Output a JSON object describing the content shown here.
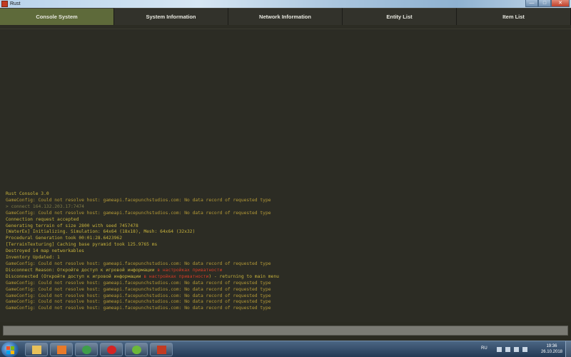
{
  "window": {
    "title": "Rust",
    "buttons": {
      "minimize": "—",
      "maximize": "□",
      "close": "✕"
    }
  },
  "tabs": [
    {
      "label": "Console System",
      "active": true
    },
    {
      "label": "System Information",
      "active": false
    },
    {
      "label": "Network Information",
      "active": false
    },
    {
      "label": "Entity List",
      "active": false
    },
    {
      "label": "Item List",
      "active": false
    }
  ],
  "console": {
    "lines": [
      {
        "pre": "Rust Console 3.0",
        "hl": "",
        "post": "",
        "kind": "normal"
      },
      {
        "pre": "GameConfig: Could not resolve host: gameapi.facepunchstudios.com: No data record of requested type",
        "hl": "",
        "post": "",
        "kind": "warn"
      },
      {
        "pre": "> connect 164.132.203.17:7474",
        "hl": "",
        "post": "",
        "kind": "cmd"
      },
      {
        "pre": "GameConfig: Could not resolve host: gameapi.facepunchstudios.com: No data record of requested type",
        "hl": "",
        "post": "",
        "kind": "warn"
      },
      {
        "pre": "Connection request accepted",
        "hl": "",
        "post": "",
        "kind": "normal"
      },
      {
        "pre": "Generating terrain of size 2800 with seed 7457478",
        "hl": "",
        "post": "",
        "kind": "normal"
      },
      {
        "pre": "[WaterEx] Initializing. Simulation: 64x64 (18x18), Mesh: 64x64 (32x32)",
        "hl": "",
        "post": "",
        "kind": "normal"
      },
      {
        "pre": "Procedural Generation took 00:01:28.6423962",
        "hl": "",
        "post": "",
        "kind": "normal"
      },
      {
        "pre": "[TerrainTexturing] Caching base pyramid took 125.9765 ms",
        "hl": "",
        "post": "",
        "kind": "normal"
      },
      {
        "pre": "Destroyed 14 map networkables",
        "hl": "",
        "post": "",
        "kind": "normal"
      },
      {
        "pre": "Inventory Updated: 1",
        "hl": "",
        "post": "",
        "kind": "normal"
      },
      {
        "pre": "GameConfig: Could not resolve host: gameapi.facepunchstudios.com: No data record of requested type",
        "hl": "",
        "post": "",
        "kind": "warn"
      },
      {
        "pre": "Disconnect Reason: Откройте доступ к игровой информации ",
        "hl": "в настройках приватности",
        "post": "",
        "kind": "normal"
      },
      {
        "pre": "Disconnected (Откройте доступ к игровой информации ",
        "hl": "в настройках приватности",
        "post": ") - returning to main menu",
        "kind": "normal"
      },
      {
        "pre": "GameConfig: Could not resolve host: gameapi.facepunchstudios.com: No data record of requested type",
        "hl": "",
        "post": "",
        "kind": "warn"
      },
      {
        "pre": "GameConfig: Could not resolve host: gameapi.facepunchstudios.com: No data record of requested type",
        "hl": "",
        "post": "",
        "kind": "warn"
      },
      {
        "pre": "GameConfig: Could not resolve host: gameapi.facepunchstudios.com: No data record of requested type",
        "hl": "",
        "post": "",
        "kind": "warn"
      },
      {
        "pre": "GameConfig: Could not resolve host: gameapi.facepunchstudios.com: No data record of requested type",
        "hl": "",
        "post": "",
        "kind": "warn"
      },
      {
        "pre": "GameConfig: Could not resolve host: gameapi.facepunchstudios.com: No data record of requested type",
        "hl": "",
        "post": "",
        "kind": "warn"
      }
    ],
    "input_value": ""
  },
  "taskbar": {
    "apps": [
      {
        "icon": "explorer-folder-icon",
        "color": "#e8c15a"
      },
      {
        "icon": "media-player-icon",
        "color": "#e87a2a"
      },
      {
        "icon": "chrome-icon",
        "color": "#3f9e4a"
      },
      {
        "icon": "opera-icon",
        "color": "#d42424"
      },
      {
        "icon": "utorrent-icon",
        "color": "#6cb83a"
      },
      {
        "icon": "rust-icon",
        "color": "#c23b22"
      }
    ],
    "language": "RU",
    "time": "19:36",
    "date": "26.10.2018"
  },
  "colors": {
    "active_tab": "#5e6a3a",
    "console_bg": "#2c2c24",
    "log_text": "#c7b23c",
    "highlight": "#d93b24"
  }
}
